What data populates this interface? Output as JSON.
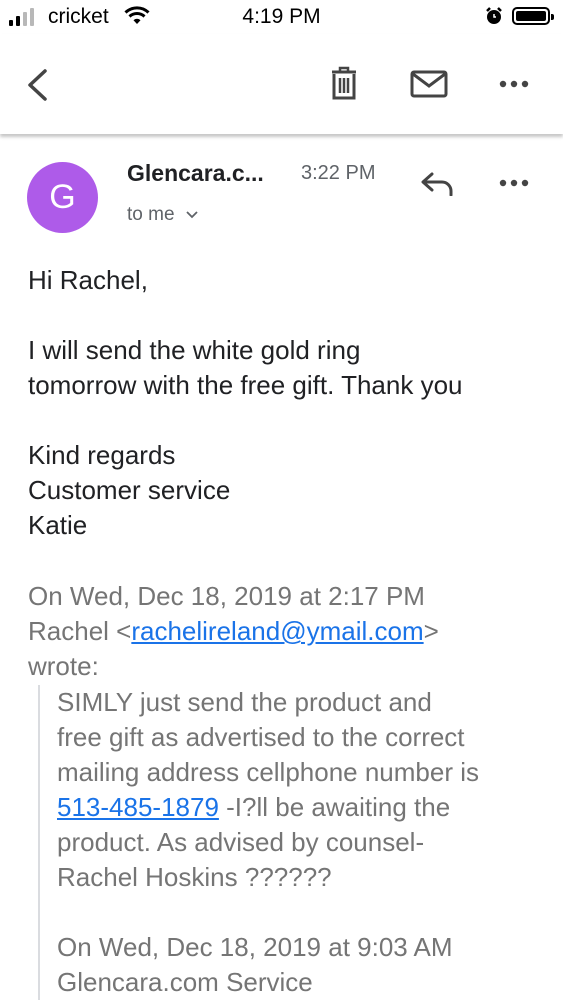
{
  "status_bar": {
    "carrier": "cricket",
    "time": "4:19 PM"
  },
  "toolbar": {
    "icons": [
      "back-arrow-icon",
      "trash-icon",
      "mail-icon",
      "more-icon"
    ]
  },
  "email": {
    "avatar_letter": "G",
    "avatar_color": "#ae5be9",
    "sender": "Glencara.c...",
    "time": "3:22 PM",
    "recipient": "to me",
    "body": {
      "greeting": "Hi Rachel,",
      "line1": "I will send the white gold ring",
      "line2": "tomorrow with the free gift. Thank you",
      "sign1": "Kind regards",
      "sign2": "Customer service",
      "sign3": "Katie"
    },
    "quote_header": {
      "line1": "On Wed, Dec 18, 2019 at 2:17 PM",
      "name": "Rachel <",
      "email": "rachelireland@ymail.com",
      "after": ">",
      "line3": "wrote:"
    },
    "quoted": {
      "line1": "SIMLY just send the product and",
      "line2": "free gift as advertised to the correct",
      "line3": "mailing address cellphone number is",
      "phone": "513-485-1879",
      "line4_rest": " -I?ll be awaiting the",
      "line5": "product. As advised by counsel-",
      "line6": "Rachel Hoskins ??????",
      "line7": "On Wed, Dec 18, 2019 at 9:03 AM",
      "line8": "Glencara.com Service"
    }
  }
}
